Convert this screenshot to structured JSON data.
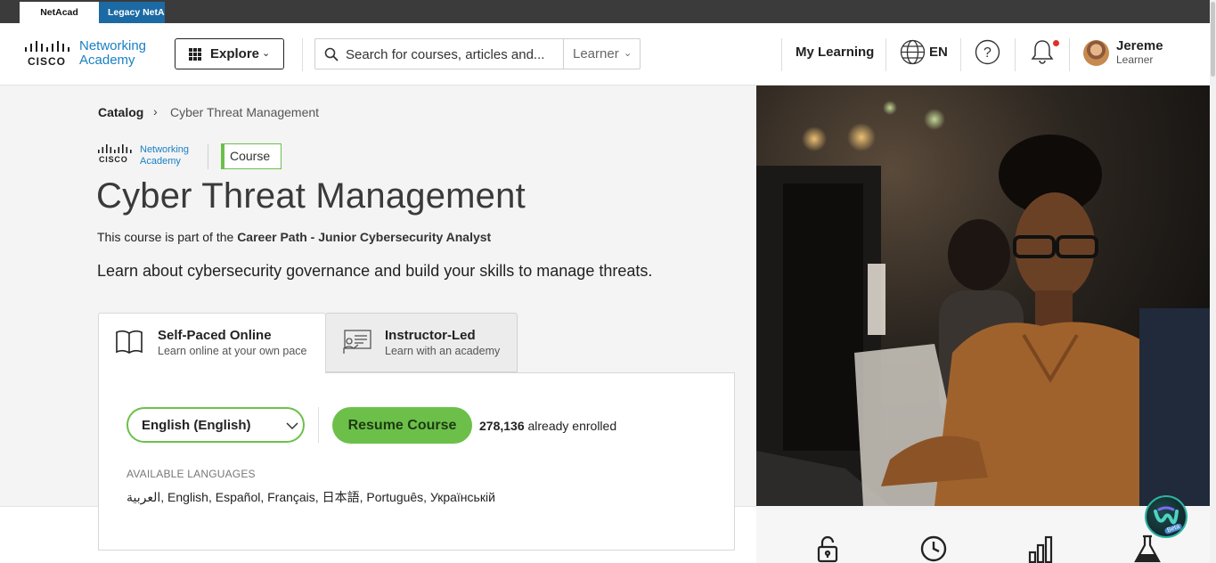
{
  "topbar": {
    "tabs": [
      "NetAcad",
      "Legacy NetAcad"
    ]
  },
  "header": {
    "logo": {
      "brand": "CISCO",
      "product_line1": "Networking",
      "product_line2": "Academy"
    },
    "explore_label": "Explore",
    "search": {
      "placeholder": "Search for courses, articles and...",
      "role_filter": "Learner"
    },
    "my_learning": "My Learning",
    "language": "EN",
    "user": {
      "name": "Jereme",
      "role": "Learner"
    },
    "icons": [
      "grid-icon",
      "search-icon",
      "globe-icon",
      "help-icon",
      "bell-icon"
    ]
  },
  "breadcrumb": {
    "root": "Catalog",
    "current": "Cyber Threat Management"
  },
  "course": {
    "badge": "Course",
    "title": "Cyber Threat Management",
    "partof_prefix": "This course is part of the ",
    "partof_path": "Career Path - Junior Cybersecurity Analyst",
    "description": "Learn about cybersecurity governance and build your skills to manage threats."
  },
  "delivery_tabs": [
    {
      "title": "Self-Paced Online",
      "subtitle": "Learn online at your own pace",
      "selected": true
    },
    {
      "title": "Instructor-Led",
      "subtitle": "Learn with an academy",
      "selected": false
    }
  ],
  "enroll": {
    "language_selected": "English (English)",
    "button": "Resume Course",
    "enrolled_count": "278,136",
    "enrolled_suffix": " already enrolled",
    "available_label": "AVAILABLE LANGUAGES",
    "available_list": "العربية, English, Español, Français, 日本語, Português, Українській"
  },
  "stats_icons": [
    "unlock-icon",
    "clock-icon",
    "bar-chart-icon",
    "lab-flask-icon"
  ],
  "widget": {
    "badge": "Beta"
  },
  "colors": {
    "accent_green": "#6cc04a",
    "cisco_blue": "#1a80c4",
    "legacy_tab": "#1c6aa3",
    "top_strip": "#3b3b3b"
  }
}
